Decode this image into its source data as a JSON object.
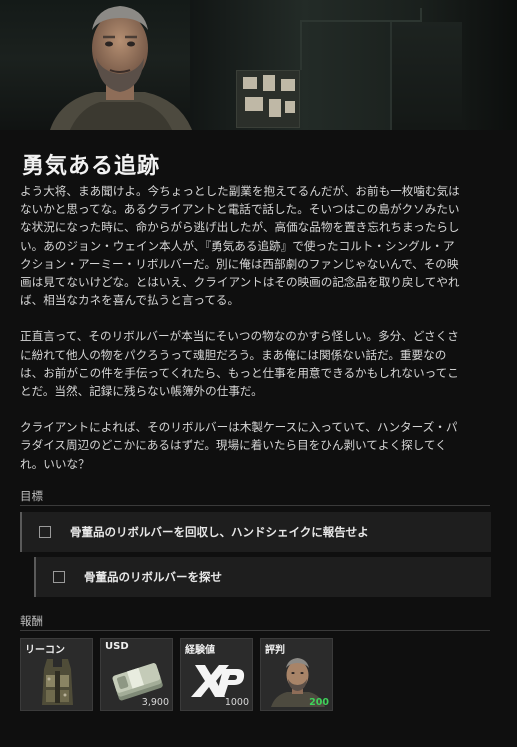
{
  "mission": {
    "title": "勇気ある追跡",
    "paragraphs": [
      "よう大将、まあ聞けよ。今ちょっとした副業を抱えてるんだが、お前も一枚噛む気は\nないかと思ってな。あるクライアントと電話で話した。そいつはこの島がクソみたい\nな状況になった時に、命からがら逃げ出したが、高価な品物を置き忘れちまったらし\nい。あのジョン・ウェイン本人が、『勇気ある追跡』で使ったコルト・シングル・ア\nクション・アーミー・リボルバーだ。別に俺は西部劇のファンじゃないんで、その映\n画は見てないけどな。とはいえ、クライアントはその映画の記念品を取り戻してやれ\nば、相当なカネを喜んで払うと言ってる。",
      "正直言って、そのリボルバーが本当にそいつの物なのかすら怪しい。多分、どさくさ\nに紛れて他人の物をパクろうって魂胆だろう。まあ俺には関係ない話だ。重要なの\nは、お前がこの件を手伝ってくれたら、もっと仕事を用意できるかもしれないってこ\nとだ。当然、記録に残らない帳簿外の仕事だ。",
      "クライアントによれば、そのリボルバーは木製ケースに入っていて、ハンターズ・パ\nラダイス周辺のどこかにあるはずだ。現場に着いたら目をひん剥いてよく探してく\nれ。いいな？"
    ]
  },
  "objectives": {
    "heading": "目標",
    "items": [
      {
        "label": "骨董品のリボルバーを回収し、ハンドシェイクに報告せよ",
        "checked": false
      },
      {
        "label": "骨董品のリボルバーを探せ",
        "checked": false
      }
    ]
  },
  "rewards": {
    "heading": "報酬",
    "items": [
      {
        "label": "リーコン",
        "value": "",
        "icon": "tactical-vest-icon"
      },
      {
        "label": "USD",
        "value": "3,900",
        "icon": "cash-stack-icon"
      },
      {
        "label": "経験値",
        "value": "1000",
        "icon": "xp-icon"
      },
      {
        "label": "評判",
        "value": "200",
        "icon": "handshake-portrait-icon",
        "value_color": "#3fd15a"
      }
    ]
  },
  "colors": {
    "background": "#0f0f0f",
    "objective_bg": "#1e1e1e",
    "reward_tile_bg": "#2b2b2b",
    "reputation_green": "#3fd15a"
  }
}
